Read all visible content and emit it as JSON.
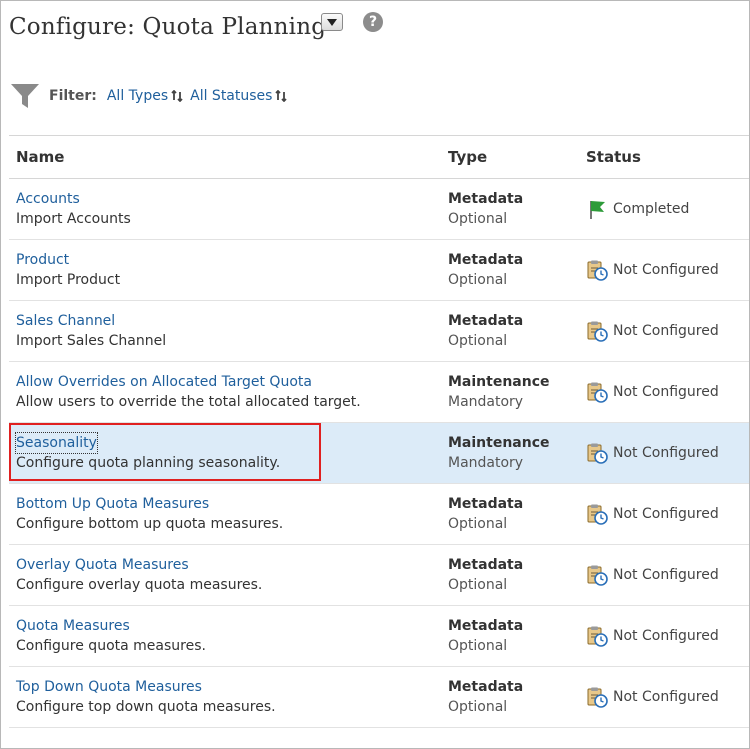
{
  "page": {
    "title": "Configure: Quota Planning"
  },
  "filter": {
    "label": "Filter:",
    "types": "All Types",
    "statuses": "All Statuses"
  },
  "table": {
    "headers": {
      "name": "Name",
      "type": "Type",
      "status": "Status"
    },
    "rows": [
      {
        "name": "Accounts",
        "description": "Import Accounts",
        "type": "Metadata",
        "requirement": "Optional",
        "status": "Completed",
        "status_icon": "green-flag-icon",
        "selected": false
      },
      {
        "name": "Product",
        "description": "Import Product",
        "type": "Metadata",
        "requirement": "Optional",
        "status": "Not Configured",
        "status_icon": "clipboard-clock-icon",
        "selected": false
      },
      {
        "name": "Sales Channel",
        "description": "Import Sales Channel",
        "type": "Metadata",
        "requirement": "Optional",
        "status": "Not Configured",
        "status_icon": "clipboard-clock-icon",
        "selected": false
      },
      {
        "name": "Allow Overrides on Allocated Target Quota",
        "description": "Allow users to override the total allocated target.",
        "type": "Maintenance",
        "requirement": "Mandatory",
        "status": "Not Configured",
        "status_icon": "clipboard-clock-icon",
        "selected": false
      },
      {
        "name": "Seasonality",
        "description": "Configure quota planning seasonality.",
        "type": "Maintenance",
        "requirement": "Mandatory",
        "status": "Not Configured",
        "status_icon": "clipboard-clock-icon",
        "selected": true
      },
      {
        "name": "Bottom Up Quota Measures",
        "description": "Configure bottom up quota measures.",
        "type": "Metadata",
        "requirement": "Optional",
        "status": "Not Configured",
        "status_icon": "clipboard-clock-icon",
        "selected": false
      },
      {
        "name": "Overlay Quota Measures",
        "description": "Configure overlay quota measures.",
        "type": "Metadata",
        "requirement": "Optional",
        "status": "Not Configured",
        "status_icon": "clipboard-clock-icon",
        "selected": false
      },
      {
        "name": "Quota Measures",
        "description": "Configure quota measures.",
        "type": "Metadata",
        "requirement": "Optional",
        "status": "Not Configured",
        "status_icon": "clipboard-clock-icon",
        "selected": false
      },
      {
        "name": "Top Down Quota Measures",
        "description": "Configure top down quota measures.",
        "type": "Metadata",
        "requirement": "Optional",
        "status": "Not Configured",
        "status_icon": "clipboard-clock-icon",
        "selected": false
      }
    ]
  },
  "colors": {
    "link": "#1f5f9c",
    "selected_row_bg": "#dcebf8",
    "highlight_box": "#e02020",
    "completed_flag": "#2e9b3a"
  }
}
